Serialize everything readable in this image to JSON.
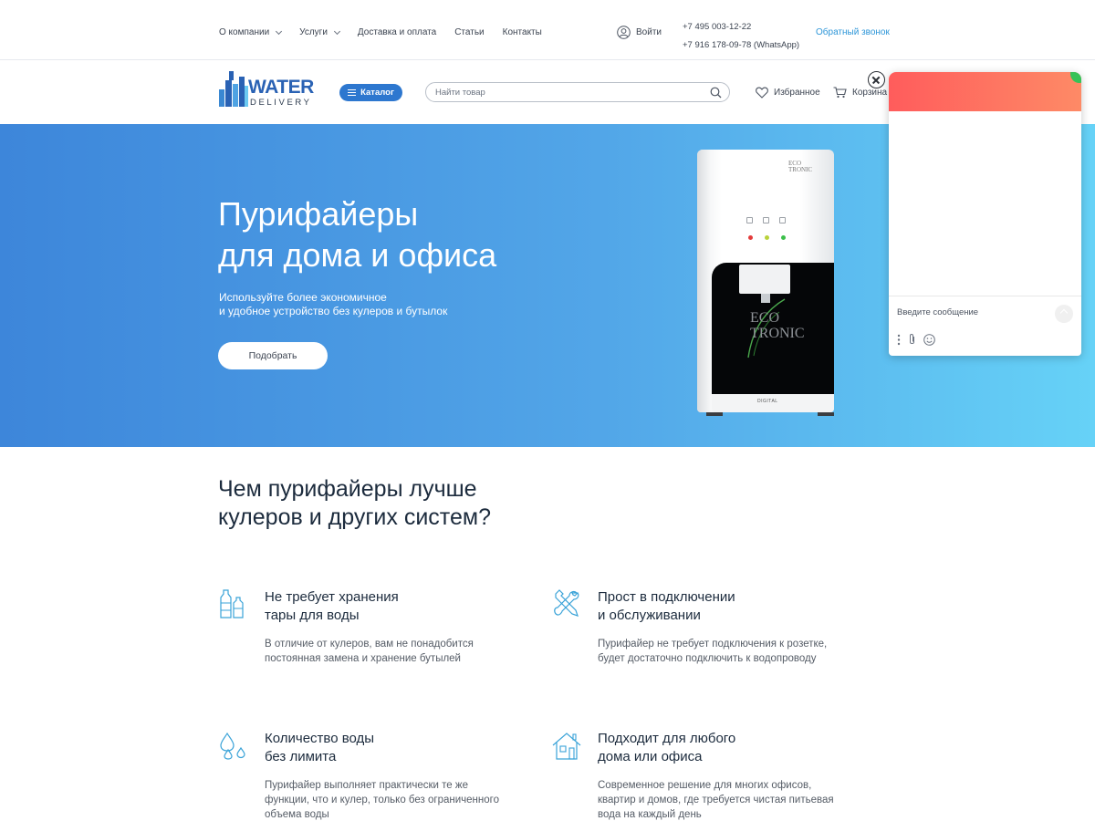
{
  "topbar": {
    "nav": [
      {
        "label": "О компании",
        "dropdown": true
      },
      {
        "label": "Услуги",
        "dropdown": true
      },
      {
        "label": "Доставка и оплата",
        "dropdown": false
      },
      {
        "label": "Статьи",
        "dropdown": false
      },
      {
        "label": "Контакты",
        "dropdown": false
      }
    ],
    "login_label": "Войти",
    "phone_1": "+7 495 003-12-22",
    "phone_2": "+7 916 178-09-78 (WhatsApp)",
    "callback_label": "Обратный звонок"
  },
  "header": {
    "logo_word_1": "WATER",
    "logo_word_2": "DELIVERY",
    "catalog_label": "Каталог",
    "search_placeholder": "Найти товар",
    "favorites_label": "Избранное",
    "cart_label": "Корзина"
  },
  "hero": {
    "title_line_1": "Пурифайеры",
    "title_line_2": "для дома и офиса",
    "subtitle_line_1": "Используйте более экономичное",
    "subtitle_line_2": "и удобное устройство без кулеров и бутылок",
    "button_label": "Подобрать",
    "product": {
      "brand_line_1": "ECO",
      "brand_line_2": "TRONIC",
      "top_logo_line_1": "ECO",
      "top_logo_line_2": "TRONIC",
      "model_label": "DIGITAL"
    }
  },
  "benefits": {
    "title_line_1": "Чем пурифайеры лучше",
    "title_line_2": "кулеров и других систем?",
    "items": [
      {
        "icon": "bottles-icon",
        "title_line_1": "Не требует хранения",
        "title_line_2": "тары для воды",
        "text": "В отличие от кулеров, вам не понадобится постоянная замена и хранение бутылей"
      },
      {
        "icon": "tools-icon",
        "title_line_1": "Прост в подключении",
        "title_line_2": "и обслуживании",
        "text": "Пурифайер не требует подключения к розетке, будет достаточно подключить к водопроводу"
      },
      {
        "icon": "water-drops-icon",
        "title_line_1": "Количество воды",
        "title_line_2": "без лимита",
        "text": "Пурифайер выполняет практически те же функции, что и кулер, только без ограниченного объема воды"
      },
      {
        "icon": "house-icon",
        "title_line_1": "Подходит для любого",
        "title_line_2": "дома или офиса",
        "text": "Современное решение для многих офисов, квартир и домов, где требуется чистая питьевая вода на каждый день"
      }
    ]
  },
  "chat": {
    "input_placeholder": "Введите сообщение"
  },
  "colors": {
    "brand_blue": "#2a62b4",
    "catalog_button": "#2d77cf",
    "link_blue": "#2d96d8",
    "hero_gradient_start": "#3d86da",
    "hero_gradient_end": "#66d2f7",
    "chat_header_start": "#ff5c5c",
    "chat_header_end": "#fe8a66",
    "icon_blue": "#3aa3d8"
  }
}
